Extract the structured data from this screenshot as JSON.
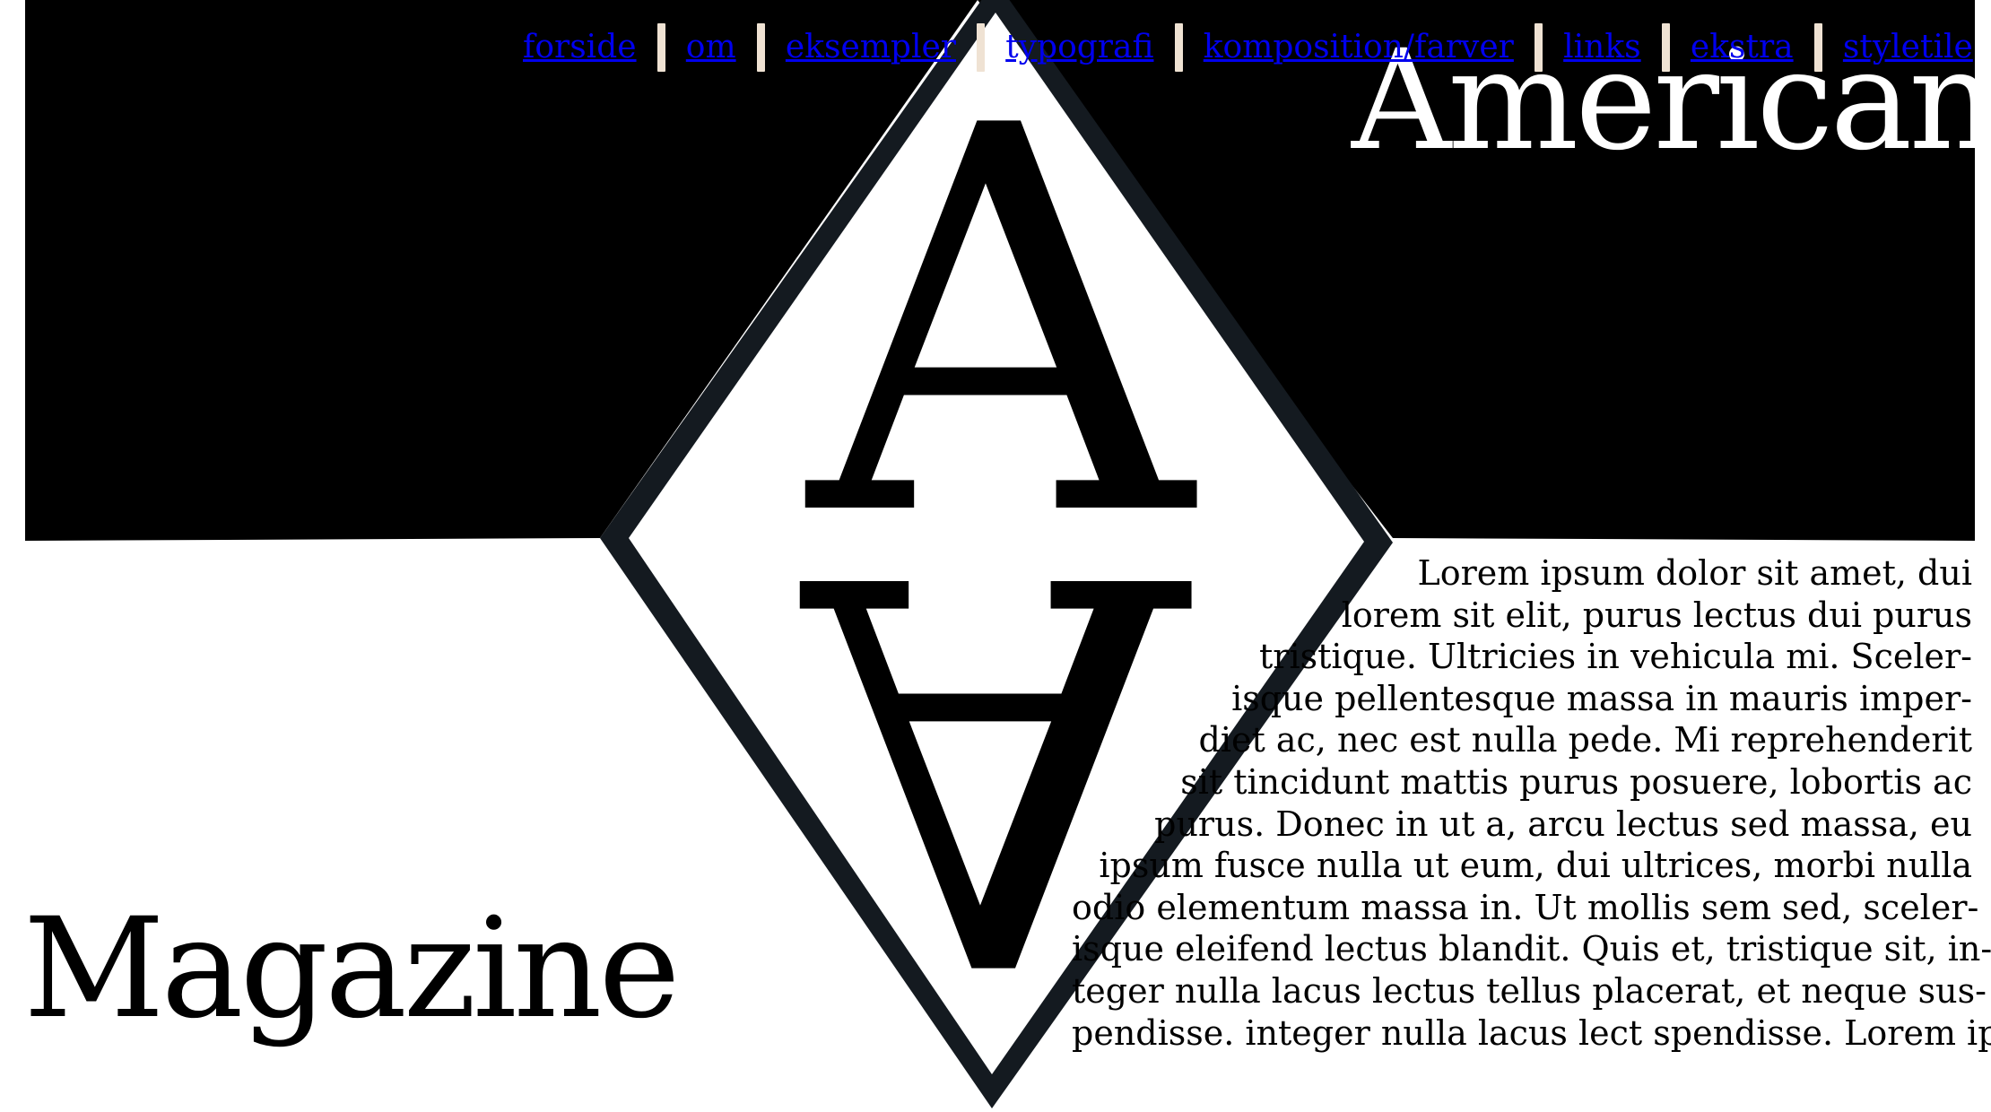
{
  "nav": {
    "links": [
      "forside",
      "om",
      "eksempler",
      "typografi",
      "komposition/farver",
      "links",
      "ekstra",
      "styletile"
    ]
  },
  "hero": {
    "logo_letters": {
      "top": "A",
      "bottom": "A"
    },
    "title_top": "American",
    "title_bottom": "Magazine"
  },
  "body": {
    "lines": [
      "Lorem ipsum dolor sit amet, dui",
      "lorem sit elit, purus lectus dui purus",
      "tristique. Ultricies in vehicula mi. Sceler-",
      "isque pellentesque massa in mauris imper-",
      "diet ac, nec est nulla pede. Mi reprehenderit",
      "sit tincidunt mattis purus posuere, lobortis ac",
      "purus. Donec in ut a, arcu lectus sed massa, eu",
      "ipsum fusce nulla ut eum, dui ultrices, morbi nulla",
      "odio elementum massa in. Ut mollis sem sed, sceler-",
      "isque eleifend lectus blandit. Quis et, tristique sit, in-",
      "teger nulla lacus lectus tellus placerat, et neque sus-",
      "pendisse. integer nulla lacus lect spendisse. Lorem ipsum"
    ]
  },
  "colors": {
    "black_band": "#000000",
    "diamond_outline": "#141a20",
    "link": "#0000ee",
    "separator": "#efe2d3",
    "background": "#ffffff"
  }
}
